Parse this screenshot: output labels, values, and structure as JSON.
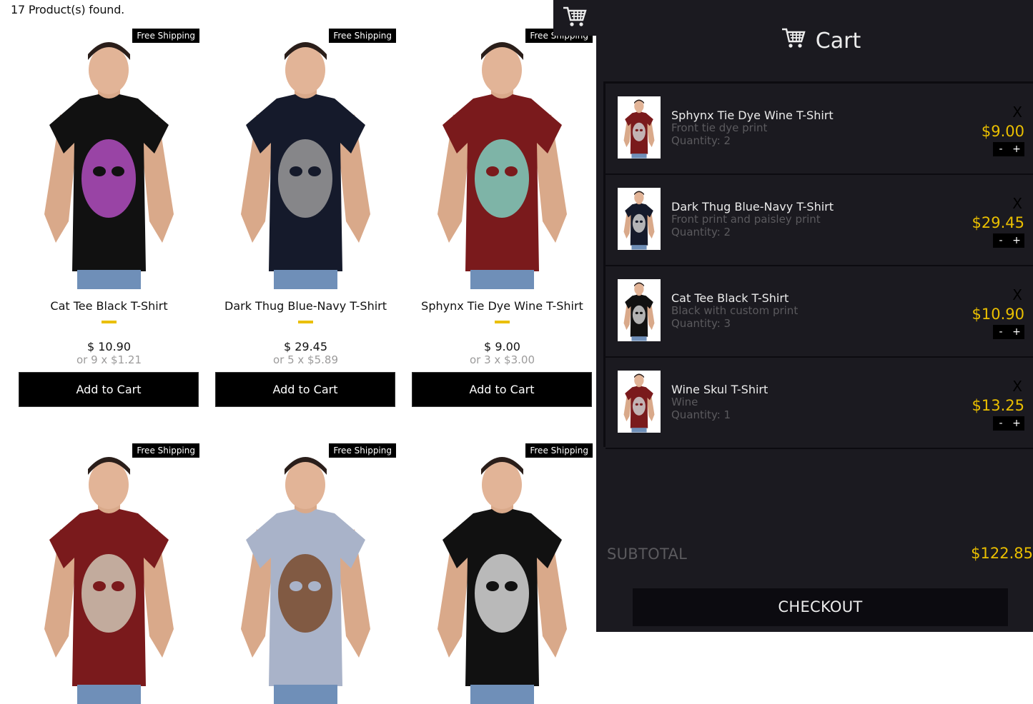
{
  "shelf": {
    "products_found": "17 Product(s) found.",
    "badge_label": "Free Shipping",
    "add_label": "Add to Cart",
    "products": [
      {
        "title": "Cat Tee Black T-Shirt",
        "price": "$ 10.90",
        "installment": "or 9 x $1.21",
        "shirt_color": "#111111",
        "print_color": "#b14ec0"
      },
      {
        "title": "Dark Thug Blue-Navy T-Shirt",
        "price": "$ 29.45",
        "installment": "or 5 x $5.89",
        "shirt_color": "#151a2b",
        "print_color": "#9a9a9a"
      },
      {
        "title": "Sphynx Tie Dye Wine T-Shirt",
        "price": "$ 9.00",
        "installment": "or 3 x $3.00",
        "shirt_color": "#7a1a1c",
        "print_color": "#7fd0c0"
      },
      {
        "title": "",
        "price": "",
        "installment": "",
        "shirt_color": "#7a1a1c",
        "print_color": "#cfc6b4"
      },
      {
        "title": "",
        "price": "",
        "installment": "",
        "shirt_color": "#a9b3c9",
        "print_color": "#7a4a2b"
      },
      {
        "title": "",
        "price": "",
        "installment": "",
        "shirt_color": "#111111",
        "print_color": "#d7d7d7"
      }
    ]
  },
  "cart": {
    "title": "Cart",
    "remove_label": "X",
    "minus_label": "-",
    "plus_label": "+",
    "items": [
      {
        "title": "Sphynx Tie Dye Wine T-Shirt",
        "desc": "Front tie dye print",
        "quantity": "Quantity: 2",
        "price": "$9.00",
        "shirt_color": "#7a1a1c"
      },
      {
        "title": "Dark Thug Blue-Navy T-Shirt",
        "desc": "Front print and paisley print",
        "quantity": "Quantity: 2",
        "price": "$29.45",
        "shirt_color": "#151a2b"
      },
      {
        "title": "Cat Tee Black T-Shirt",
        "desc": "Black with custom print",
        "quantity": "Quantity: 3",
        "price": "$10.90",
        "shirt_color": "#111111"
      },
      {
        "title": "Wine Skul T-Shirt",
        "desc": "Wine",
        "quantity": "Quantity: 1",
        "price": "$13.25",
        "shirt_color": "#7a1a1c"
      }
    ],
    "subtotal_label": "SUBTOTAL",
    "subtotal_value": "$122.85",
    "checkout_label": "CHECKOUT"
  },
  "colors": {
    "accent": "#eabf00",
    "cart_bg": "#1b1a20",
    "cart_dark": "#0c0b10"
  }
}
